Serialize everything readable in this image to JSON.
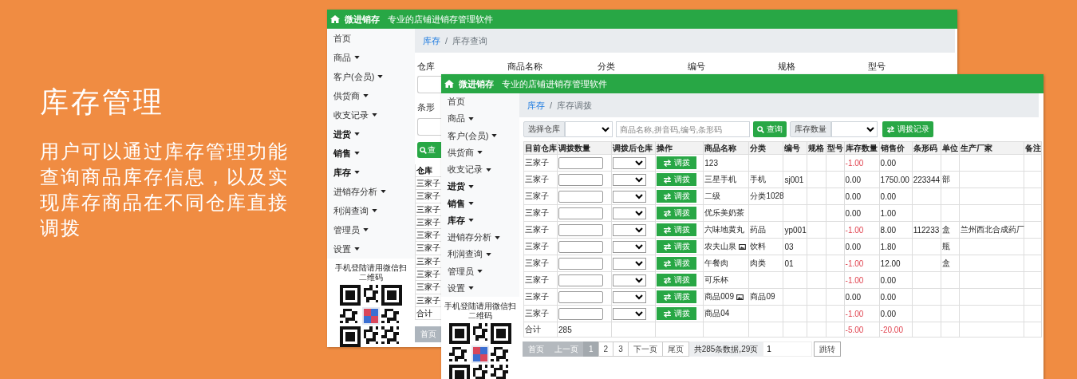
{
  "intro": {
    "title": "库存管理",
    "text": "用户可以通过库存管理功能查询商品库存信息，以及实现库存商品在不同仓库直接调拨"
  },
  "back_window": {
    "header": {
      "brand": "微进销存",
      "tagline": "专业的店铺进销存管理软件"
    },
    "sidebar": {
      "items": [
        {
          "label": "首页",
          "dropdown": false,
          "bold": false
        },
        {
          "label": "商品",
          "dropdown": true,
          "bold": false
        },
        {
          "label": "客户(会员)",
          "dropdown": true,
          "bold": false
        },
        {
          "label": "供货商",
          "dropdown": true,
          "bold": false
        },
        {
          "label": "收支记录",
          "dropdown": true,
          "bold": false
        },
        {
          "label": "进货",
          "dropdown": true,
          "bold": true
        },
        {
          "label": "销售",
          "dropdown": true,
          "bold": true
        },
        {
          "label": "库存",
          "dropdown": true,
          "bold": true
        },
        {
          "label": "进销存分析",
          "dropdown": true,
          "bold": false
        },
        {
          "label": "利润查询",
          "dropdown": true,
          "bold": false
        },
        {
          "label": "管理员",
          "dropdown": true,
          "bold": false
        },
        {
          "label": "设置",
          "dropdown": true,
          "bold": false
        }
      ],
      "qr_caption": "手机登陆请用微信扫二维码"
    },
    "breadcrumb": {
      "items": [
        {
          "label": "库存",
          "link": true
        },
        {
          "label": "库存查询",
          "link": false
        }
      ],
      "separator": "/"
    },
    "filter_labels": [
      "仓库",
      "商品名称",
      "分类",
      "编号",
      "规格",
      "型号"
    ],
    "filter_label_2": "条形",
    "search_button": "查",
    "table": {
      "column": "仓库",
      "rows": [
        "三家子",
        "三家子",
        "三家子",
        "三家子",
        "三家子",
        "三家子",
        "三家子",
        "三家子",
        "三家子",
        "三家子"
      ],
      "total": "合计"
    },
    "pager_first": "首页"
  },
  "front_window": {
    "header": {
      "brand": "微进销存",
      "tagline": "专业的店铺进销存管理软件"
    },
    "sidebar": {
      "items": [
        {
          "label": "首页",
          "dropdown": false,
          "bold": false
        },
        {
          "label": "商品",
          "dropdown": true,
          "bold": false
        },
        {
          "label": "客户(会员)",
          "dropdown": true,
          "bold": false
        },
        {
          "label": "供货商",
          "dropdown": true,
          "bold": false
        },
        {
          "label": "收支记录",
          "dropdown": true,
          "bold": false
        },
        {
          "label": "进货",
          "dropdown": true,
          "bold": true
        },
        {
          "label": "销售",
          "dropdown": true,
          "bold": true
        },
        {
          "label": "库存",
          "dropdown": true,
          "bold": true
        },
        {
          "label": "进销存分析",
          "dropdown": true,
          "bold": false
        },
        {
          "label": "利润查询",
          "dropdown": true,
          "bold": false
        },
        {
          "label": "管理员",
          "dropdown": true,
          "bold": false
        },
        {
          "label": "设置",
          "dropdown": true,
          "bold": false
        }
      ],
      "qr_caption": "手机登陆请用微信扫二维码"
    },
    "breadcrumb": {
      "items": [
        {
          "label": "库存",
          "link": true
        },
        {
          "label": "库存调拨",
          "link": false
        }
      ],
      "separator": "/"
    },
    "toolbar": {
      "warehouse_label": "选择仓库",
      "search": {
        "placeholder": "商品名称,拼音码,编号,条形码"
      },
      "search_button": "查询",
      "stock_label": "库存数量",
      "records_button": "调拨记录"
    },
    "table": {
      "columns": [
        "目前仓库",
        "调拨数量",
        "调拨后仓库",
        "操作",
        "商品名称",
        "分类",
        "编号",
        "规格",
        "型号",
        "库存数量",
        "销售价",
        "条形码",
        "单位",
        "生产厂家",
        "备注"
      ],
      "rows": [
        {
          "warehouse": "三家子",
          "action": "调拨",
          "name": "123",
          "has_image": false,
          "stock": "-1.00",
          "stock_negative": true,
          "price": "0.00"
        },
        {
          "warehouse": "三家子",
          "action": "调拨",
          "name": "三星手机",
          "has_image": false,
          "category": "手机",
          "code": "sj001",
          "stock": "0.00",
          "stock_negative": false,
          "price": "1750.00",
          "barcode": "223344",
          "unit": "部"
        },
        {
          "warehouse": "三家子",
          "action": "调拨",
          "name": "二级",
          "has_image": false,
          "category": "分类1028",
          "stock": "0.00",
          "stock_negative": false,
          "price": "0.00"
        },
        {
          "warehouse": "三家子",
          "action": "调拨",
          "name": "优乐美奶茶",
          "has_image": false,
          "stock": "0.00",
          "stock_negative": false,
          "price": "1.00"
        },
        {
          "warehouse": "三家子",
          "action": "调拨",
          "name": "六味地黄丸",
          "has_image": false,
          "category": "药品",
          "code": "yp001",
          "stock": "-1.00",
          "stock_negative": true,
          "price": "8.00",
          "barcode": "112233",
          "unit": "盒",
          "maker": "兰州西北合成药厂"
        },
        {
          "warehouse": "三家子",
          "action": "调拨",
          "name": "农夫山泉",
          "has_image": true,
          "category": "饮料",
          "code": "03",
          "stock": "0.00",
          "stock_negative": false,
          "price": "1.80",
          "unit": "瓶"
        },
        {
          "warehouse": "三家子",
          "action": "调拨",
          "name": "午餐肉",
          "has_image": false,
          "category": "肉类",
          "code": "01",
          "stock": "-1.00",
          "stock_negative": true,
          "price": "12.00",
          "unit": "盒"
        },
        {
          "warehouse": "三家子",
          "action": "调拨",
          "name": "可乐杯",
          "has_image": false,
          "stock": "-1.00",
          "stock_negative": true,
          "price": "0.00"
        },
        {
          "warehouse": "三家子",
          "action": "调拨",
          "name": "商品009",
          "has_image": true,
          "category": "商品09",
          "stock": "0.00",
          "stock_negative": false,
          "price": "0.00"
        },
        {
          "warehouse": "三家子",
          "action": "调拨",
          "name": "商品04",
          "has_image": false,
          "stock": "-1.00",
          "stock_negative": true,
          "price": "0.00"
        }
      ],
      "total": {
        "label": "合计",
        "quantity": "285",
        "stock": "-5.00",
        "stock_negative": true,
        "price": "-20.00",
        "price_negative": true
      }
    },
    "pager": {
      "buttons": [
        {
          "label": "首页",
          "disabled": true,
          "selected": false
        },
        {
          "label": "上一页",
          "disabled": true,
          "selected": false
        },
        {
          "label": "1",
          "disabled": false,
          "selected": true
        },
        {
          "label": "2",
          "disabled": false,
          "selected": false
        },
        {
          "label": "3",
          "disabled": false,
          "selected": false
        },
        {
          "label": "下一页",
          "disabled": false,
          "selected": false
        },
        {
          "label": "尾页",
          "disabled": false,
          "selected": false
        }
      ],
      "info": "共285条数据,29页",
      "page_input": "1",
      "go_button": "跳转"
    }
  }
}
